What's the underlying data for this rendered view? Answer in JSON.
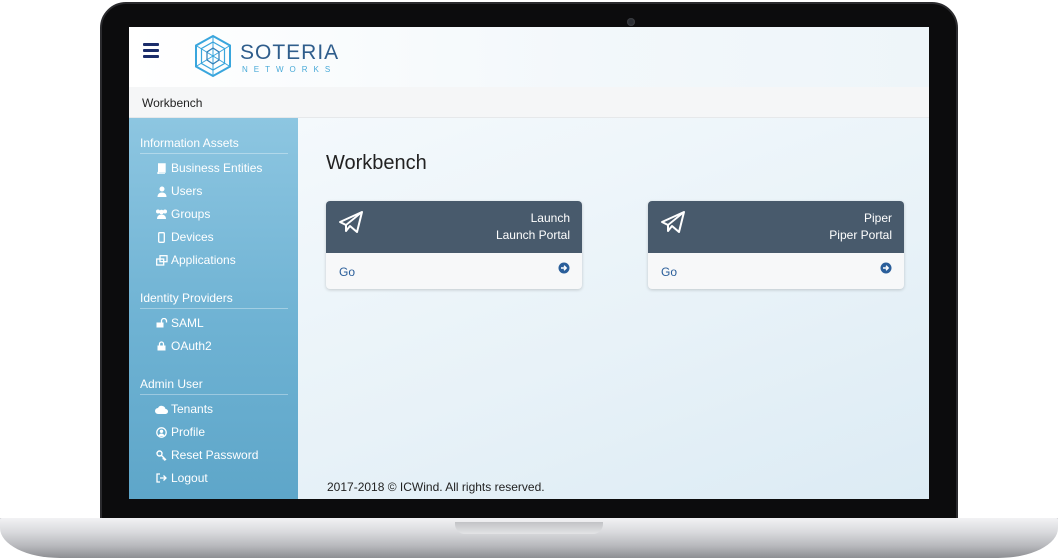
{
  "app": {
    "logo_word": "SOTERIA",
    "logo_sub": "NETWORKS"
  },
  "breadcrumb": "Workbench",
  "sidebar": {
    "sections": [
      {
        "heading": "Information Assets",
        "items": [
          {
            "label": "Business Entities",
            "icon": "book-icon"
          },
          {
            "label": "Users",
            "icon": "user-icon"
          },
          {
            "label": "Groups",
            "icon": "users-icon"
          },
          {
            "label": "Devices",
            "icon": "mobile-icon"
          },
          {
            "label": "Applications",
            "icon": "windows-icon"
          }
        ]
      },
      {
        "heading": "Identity Providers",
        "items": [
          {
            "label": "SAML",
            "icon": "unlock-icon"
          },
          {
            "label": "OAuth2",
            "icon": "lock-icon"
          }
        ]
      },
      {
        "heading": "Admin User",
        "items": [
          {
            "label": "Tenants",
            "icon": "cloud-icon"
          },
          {
            "label": "Profile",
            "icon": "user-circle-icon"
          },
          {
            "label": "Reset Password",
            "icon": "key-icon"
          },
          {
            "label": "Logout",
            "icon": "sign-out-icon"
          }
        ]
      }
    ]
  },
  "main": {
    "title": "Workbench",
    "cards": [
      {
        "title": "Launch",
        "subtitle": "Launch Portal",
        "action": "Go"
      },
      {
        "title": "Piper",
        "subtitle": "Piper Portal",
        "action": "Go"
      }
    ],
    "footer": "2017-2018 © ICWind. All rights reserved."
  },
  "colors": {
    "card_header": "#485a6c",
    "sidebar": "#6eb2d3",
    "link": "#2a5e9a",
    "brand": "#2f5d8c"
  }
}
